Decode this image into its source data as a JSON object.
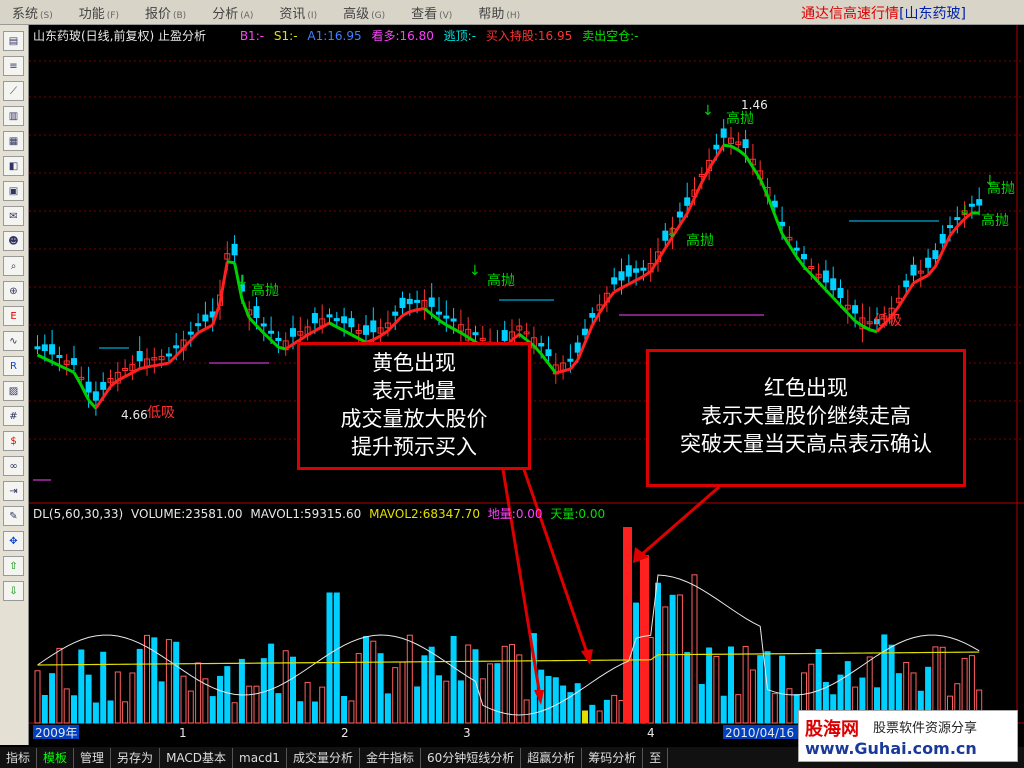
{
  "menu": [
    {
      "label": "系统",
      "key": "(S)"
    },
    {
      "label": "功能",
      "key": "(F)"
    },
    {
      "label": "报价",
      "key": "(B)"
    },
    {
      "label": "分析",
      "key": "(A)"
    },
    {
      "label": "资讯",
      "key": "(I)"
    },
    {
      "label": "高级",
      "key": "(G)"
    },
    {
      "label": "查看",
      "key": "(V)"
    },
    {
      "label": "帮助",
      "key": "(H)"
    }
  ],
  "app_title": "通达信高速行情",
  "app_stock": "[山东药玻]",
  "toolbar_icons": [
    "quote-icon",
    "list-icon",
    "kline-icon",
    "chart-icon",
    "table-icon",
    "sector-icon",
    "news-icon",
    "mail-icon",
    "users-icon",
    "search-icon",
    "zoom-icon",
    "etf-icon",
    "line-icon",
    "rsi-icon",
    "image-icon",
    "calc-icon",
    "dollar-icon",
    "link-icon",
    "exit-icon",
    "pencil-icon",
    "move-icon",
    "up-arrow-icon",
    "down-arrow-icon"
  ],
  "header": {
    "title": "山东药玻(日线,前复权) 止盈分析",
    "b1": "B1:-",
    "s1": "S1:-",
    "a1": "A1:16.95",
    "kanduo": "看多:16.80",
    "taoding": "逃顶:-",
    "mairu": "买入持股:16.95",
    "maichu": "卖出空仓:-"
  },
  "colors": {
    "accent_red": "#ff2020",
    "ma_green": "#00d000",
    "candle_up": "#ff3030",
    "candle_down": "#00d0ff",
    "ma_yellow": "#e0e000",
    "ma_white": "#e8e8e8"
  },
  "signals": {
    "high_sell": "高抛",
    "low_buy": "低吸",
    "low_price": "4.66",
    "peak_price": "1.46"
  },
  "volume_header": {
    "dl": "DL(5,60,30,33)",
    "volume": "VOLUME:23581.00",
    "mavol1": "MAVOL1:59315.60",
    "mavol2": "MAVOL2:68347.70",
    "diliang": "地量:0.00",
    "tianliang": "天量:0.00"
  },
  "annotation_yellow": [
    "黄色出现",
    "表示地量",
    "成交量放大股价",
    "提升预示买入"
  ],
  "annotation_red": [
    "红色出现",
    "表示天量股价继续走高",
    "突破天量当天高点表示确认"
  ],
  "x_axis": {
    "start": "2009年",
    "m1": "1",
    "m2": "2",
    "m3": "3",
    "m4": "4",
    "date": "2010/04/16"
  },
  "tabs": [
    "指标",
    "模板",
    "管理",
    "另存为",
    "MACD基本",
    "macd1",
    "成交量分析",
    "金牛指标",
    "60分钟短线分析",
    "超赢分析",
    "筹码分析",
    "至"
  ],
  "watermark": {
    "brand": "股海网",
    "sub": "股票软件资源分享",
    "url": "www.Guhai.com.cn"
  }
}
